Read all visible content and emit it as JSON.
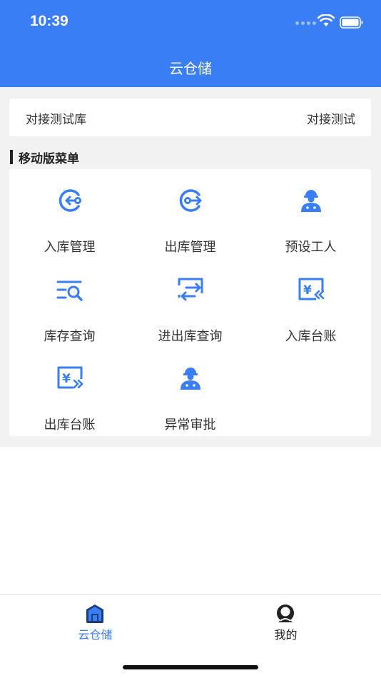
{
  "status": {
    "time": "10:39"
  },
  "nav": {
    "title": "云仓储"
  },
  "warehouse": {
    "name": "对接测试库",
    "value": "对接测试"
  },
  "section": {
    "title": "移动版菜单"
  },
  "menu": [
    {
      "label": "入库管理",
      "icon": "inbound-icon"
    },
    {
      "label": "出库管理",
      "icon": "outbound-icon"
    },
    {
      "label": "预设工人",
      "icon": "worker-icon"
    },
    {
      "label": "库存查询",
      "icon": "inventory-search-icon"
    },
    {
      "label": "进出库查询",
      "icon": "transfer-icon"
    },
    {
      "label": "入库台账",
      "icon": "inbound-ledger-icon"
    },
    {
      "label": "出库台账",
      "icon": "outbound-ledger-icon"
    },
    {
      "label": "异常审批",
      "icon": "approval-worker-icon"
    }
  ],
  "tabs": [
    {
      "label": "云仓储",
      "icon": "warehouse-icon",
      "active": true
    },
    {
      "label": "我的",
      "icon": "profile-icon",
      "active": false
    }
  ],
  "colors": {
    "primary": "#3a7ef5",
    "background": "#f2f2f2",
    "text": "#333333"
  }
}
